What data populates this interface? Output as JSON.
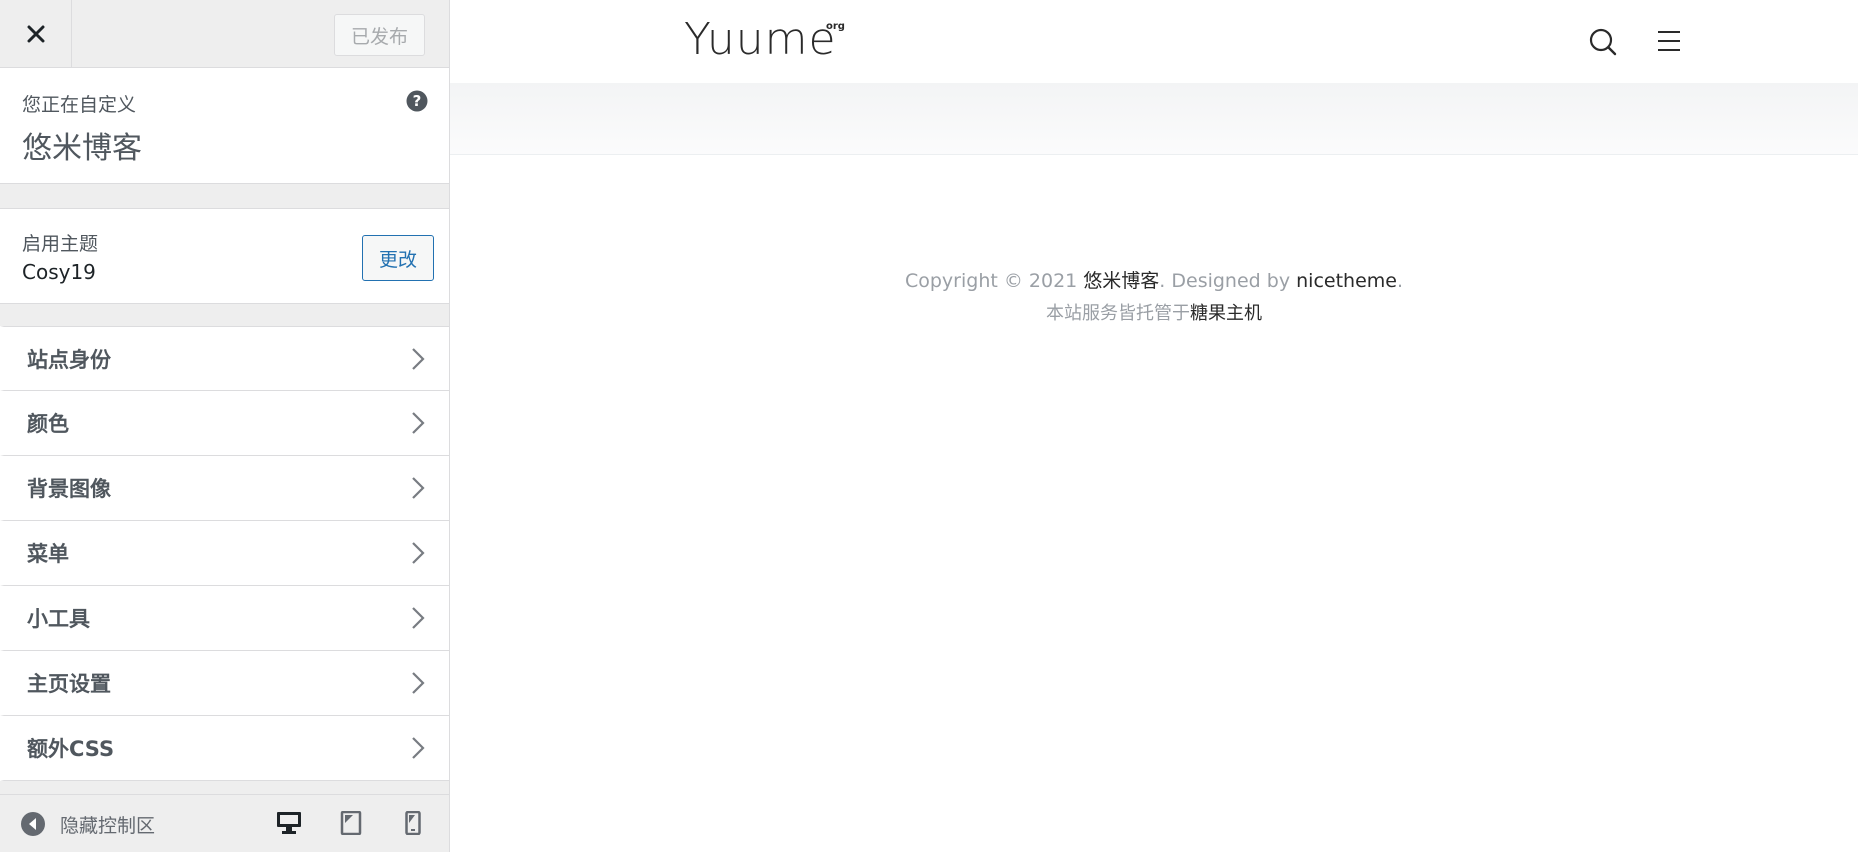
{
  "sidebar": {
    "publish_label": "已发布",
    "customizing_label": "您正在自定义",
    "site_title": "悠米博客",
    "theme_label": "启用主题",
    "theme_name": "Cosy19",
    "change_label": "更改",
    "items": [
      {
        "label": "站点身份"
      },
      {
        "label": "颜色"
      },
      {
        "label": "背景图像"
      },
      {
        "label": "菜单"
      },
      {
        "label": "小工具"
      },
      {
        "label": "主页设置"
      },
      {
        "label": "额外CSS"
      }
    ],
    "collapse_label": "隐藏控制区"
  },
  "preview": {
    "logo_text": "Yuume",
    "logo_sup": "org",
    "copyright_prefix": "Copyright © 2021 ",
    "copyright_site": "悠米博客",
    "copyright_mid": ". Designed by ",
    "copyright_designer": "nicetheme",
    "copyright_suffix": ".",
    "hosting_prefix": "本站服务皆托管于",
    "hosting_link": "糖果主机"
  },
  "icons": {
    "close": "close-icon",
    "help": "help-icon",
    "chevron": "chevron-right-icon",
    "collapse": "collapse-arrow-icon",
    "desktop": "desktop-icon",
    "tablet": "tablet-icon",
    "mobile": "mobile-icon",
    "search": "search-icon",
    "hamburger": "hamburger-menu-icon"
  },
  "colors": {
    "accent": "#2271b1",
    "text": "#50575e",
    "muted": "#9a9fa5"
  }
}
